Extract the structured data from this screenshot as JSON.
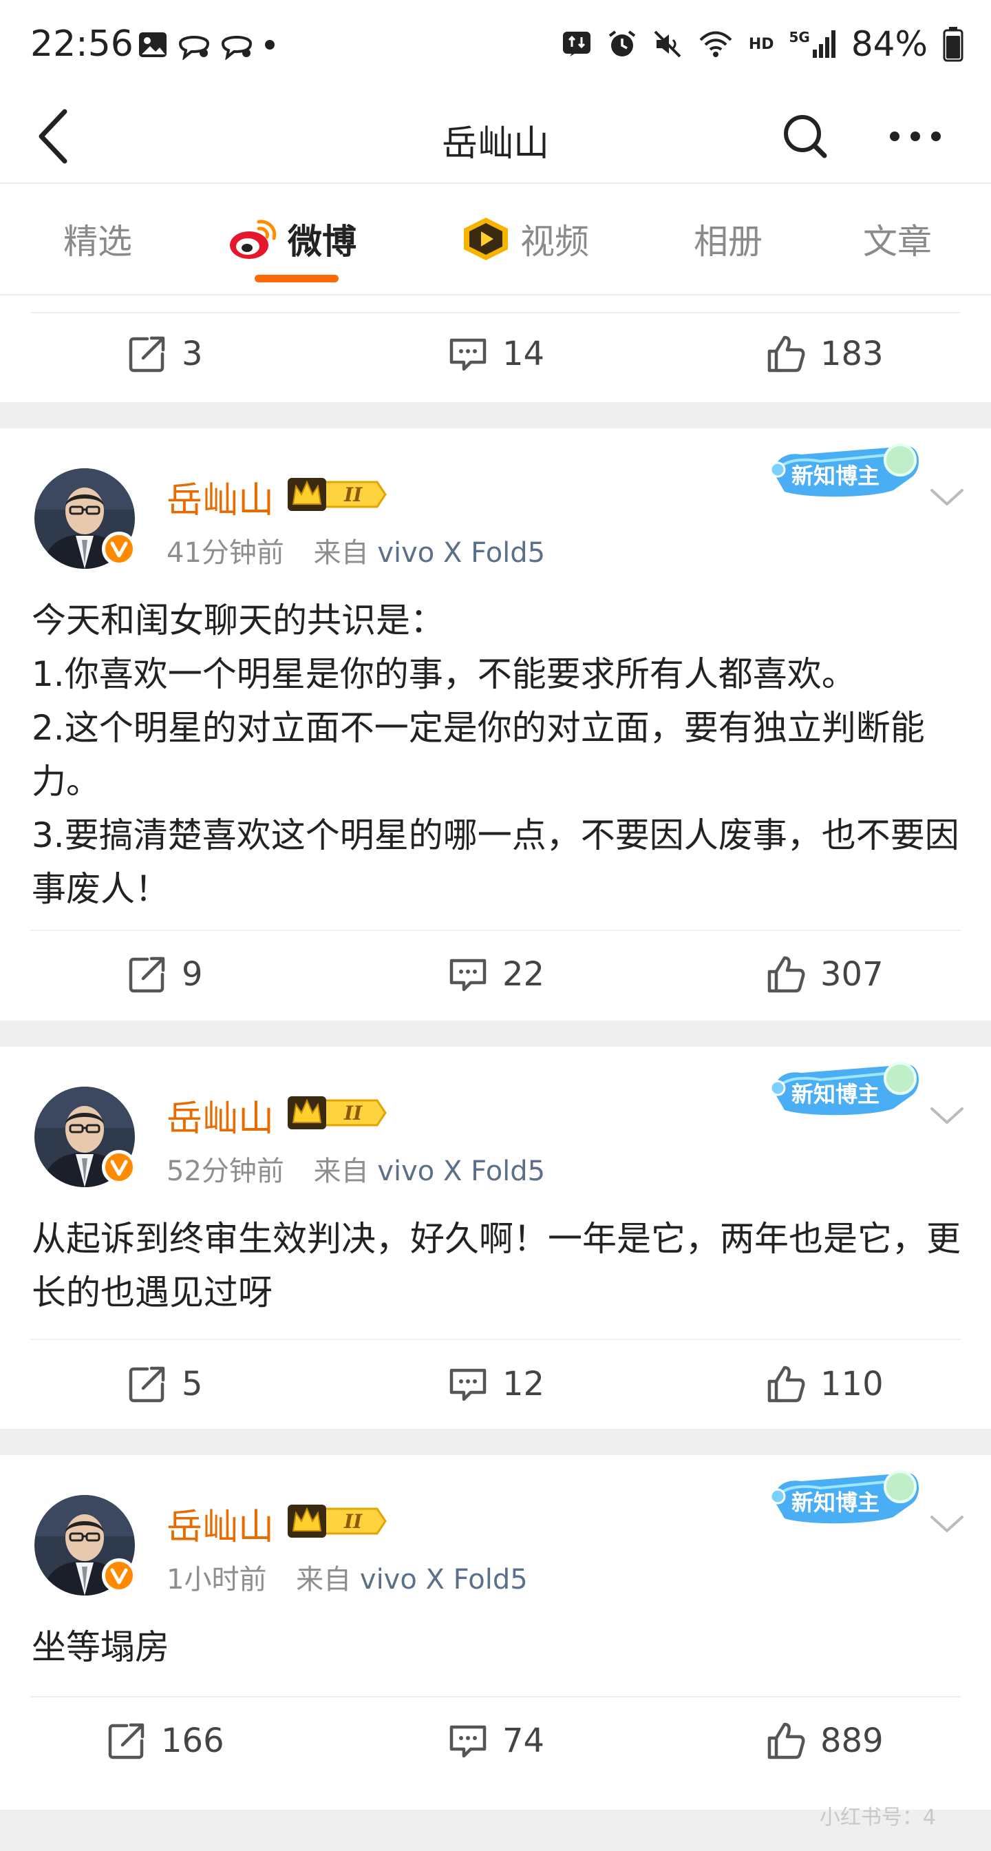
{
  "status_bar": {
    "time": "22:56",
    "battery": "84%",
    "network_hd": "HD",
    "network_5g": "5G"
  },
  "header": {
    "title": "岳屾山"
  },
  "tabs": [
    {
      "label": "精选",
      "active": false
    },
    {
      "label": "微博",
      "active": true
    },
    {
      "label": "视频",
      "active": false
    },
    {
      "label": "相册",
      "active": false
    },
    {
      "label": "文章",
      "active": false
    }
  ],
  "accent_color": "#ff6a00",
  "previous_post_actions": {
    "reposts": "3",
    "comments": "14",
    "likes": "183"
  },
  "posts": [
    {
      "author": "岳屾山",
      "vip_level": "II",
      "badge": "新知博主",
      "time": "41分钟前",
      "source_prefix": "来自",
      "source_device": "vivo X Fold5",
      "text": "今天和闺女聊天的共识是：\n1.你喜欢一个明星是你的事，不能要求所有人都喜欢。\n2.这个明星的对立面不一定是你的对立面，要有独立判断能力。\n3.要搞清楚喜欢这个明星的哪一点，不要因人废事，也不要因事废人！",
      "reposts": "9",
      "comments": "22",
      "likes": "307"
    },
    {
      "author": "岳屾山",
      "vip_level": "II",
      "badge": "新知博主",
      "time": "52分钟前",
      "source_prefix": "来自",
      "source_device": "vivo X Fold5",
      "text": "从起诉到终审生效判决，好久啊！一年是它，两年也是它，更长的也遇见过呀",
      "reposts": "5",
      "comments": "12",
      "likes": "110"
    },
    {
      "author": "岳屾山",
      "vip_level": "II",
      "badge": "新知博主",
      "time": "1小时前",
      "source_prefix": "来自",
      "source_device": "vivo X Fold5",
      "text": "坐等塌房",
      "reposts": "166",
      "comments": "74",
      "likes": "889"
    }
  ],
  "watermark": "小红书号：4"
}
